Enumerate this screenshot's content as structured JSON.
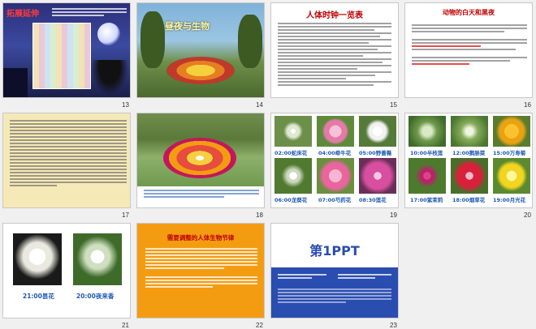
{
  "slides": [
    {
      "num": "13",
      "title": "拓展延伸"
    },
    {
      "num": "14",
      "title": "昼夜与生物"
    },
    {
      "num": "15",
      "title": "人体时钟一览表"
    },
    {
      "num": "16",
      "title": "动物的白天和黑夜"
    },
    {
      "num": "17"
    },
    {
      "num": "18"
    },
    {
      "num": "19",
      "captions": [
        "02:00蛇床花",
        "04:00牵牛花",
        "05:00野蔷薇",
        "06:00龙葵花",
        "07:00芍药花",
        "08:30莲花"
      ]
    },
    {
      "num": "20",
      "captions": [
        "10:00半枝莲",
        "12:00鹅肠菜",
        "15:00万寿菊",
        "17:00紫茉莉",
        "18:00烟草花",
        "19:00月光花"
      ]
    },
    {
      "num": "21",
      "captions": [
        "21:00昙花",
        "20:00夜来香"
      ]
    },
    {
      "num": "22",
      "title": "需要调整的人体生物节律"
    },
    {
      "num": "23",
      "logo": "第1PPT"
    }
  ],
  "colors": {
    "accent_red": "#e00000",
    "orange_bg": "#f39c12",
    "blue_bg": "#2a4db0"
  }
}
